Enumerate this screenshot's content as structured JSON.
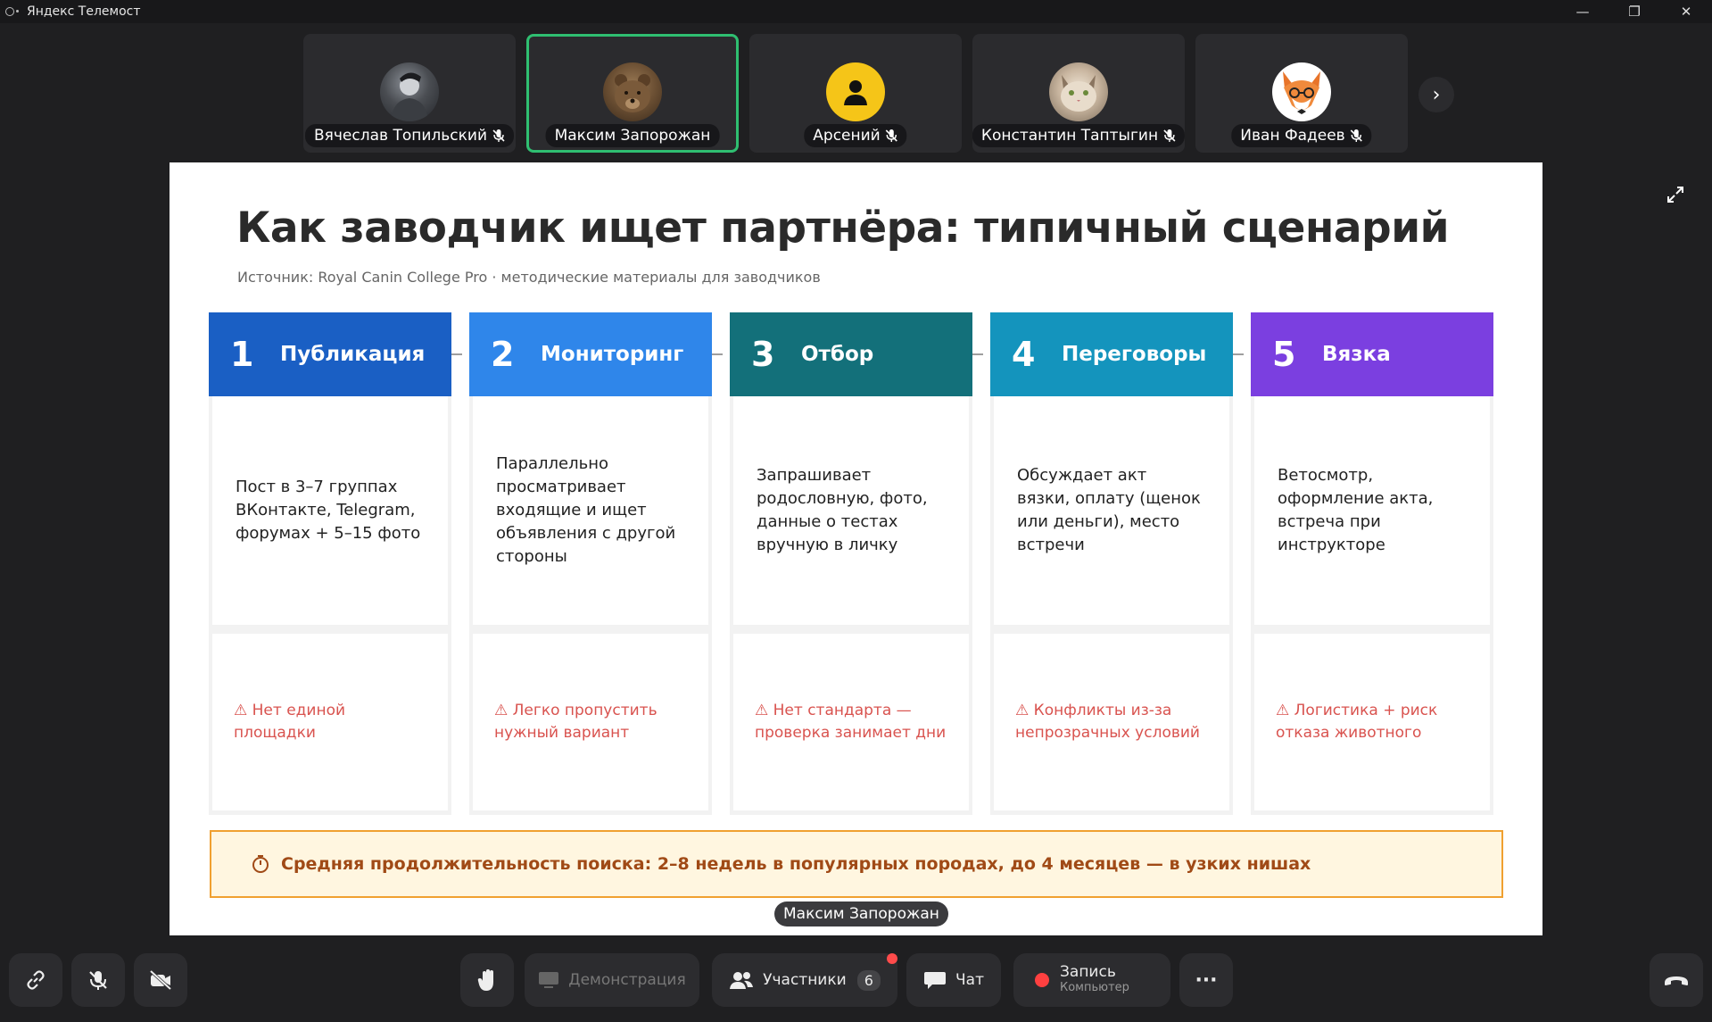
{
  "window": {
    "title": "Яндекс Телемост",
    "controls": [
      "—",
      "❐",
      "✕"
    ]
  },
  "participants": [
    {
      "name": "Вячеслав Топильский",
      "avatar": "photo-avatar",
      "muted": true,
      "active": false
    },
    {
      "name": "Максим Запорожан",
      "avatar": "bear-avatar",
      "muted": false,
      "active": true
    },
    {
      "name": "Арсений",
      "avatar": "default-user-avatar",
      "muted": true,
      "active": false
    },
    {
      "name": "Константин Таптыгин",
      "avatar": "cat-avatar",
      "muted": true,
      "active": false
    },
    {
      "name": "Иван Фадеев",
      "avatar": "fox-avatar",
      "muted": true,
      "active": false
    }
  ],
  "strip_next": "›",
  "slide": {
    "title": "Как заводчик ищет партнёра: типичный сценарий",
    "source": "Источник: Royal Canin College Pro · методические материалы для заводчиков",
    "steps": [
      {
        "num": "1",
        "name": "Публикация",
        "color": "#1a5fc4",
        "body": "Пост в 3–7 группах ВКонтакте, Telegram, форумах + 5–15 фото",
        "warning": "⚠ Нет единой площадки"
      },
      {
        "num": "2",
        "name": "Мониторинг",
        "color": "#2f86ea",
        "body": "Параллельно просматривает входящие и ищет объявления с другой стороны",
        "warning": "⚠ Легко пропустить нужный вариант"
      },
      {
        "num": "3",
        "name": "Отбор",
        "color": "#13707a",
        "body": "Запрашивает родословную, фото, данные о тестах вручную в личку",
        "warning": "⚠ Нет стандарта — проверка занимает дни"
      },
      {
        "num": "4",
        "name": "Переговоры",
        "color": "#1494bd",
        "body": "Обсуждает акт вязки, оплату (щенок или деньги), место встречи",
        "warning": "⚠ Конфликты из-за непрозрачных условий"
      },
      {
        "num": "5",
        "name": "Вязка",
        "color": "#7b3fe0",
        "body": "Ветосмотр, оформление акта, встреча при инструкторе",
        "warning": "⚠ Логистика + риск отказа животного"
      }
    ],
    "summary": "Средняя продолжительность поиска: 2–8 недель в популярных породах, до 4 месяцев — в узких нишах"
  },
  "speaker": "Максим Запорожан",
  "toolbar": {
    "demo_label": "Демонстрация",
    "participants_label": "Участники",
    "participants_count": "6",
    "chat_label": "Чат",
    "record_label": "Запись",
    "record_sub": "Компьютер",
    "more_label": "···"
  }
}
